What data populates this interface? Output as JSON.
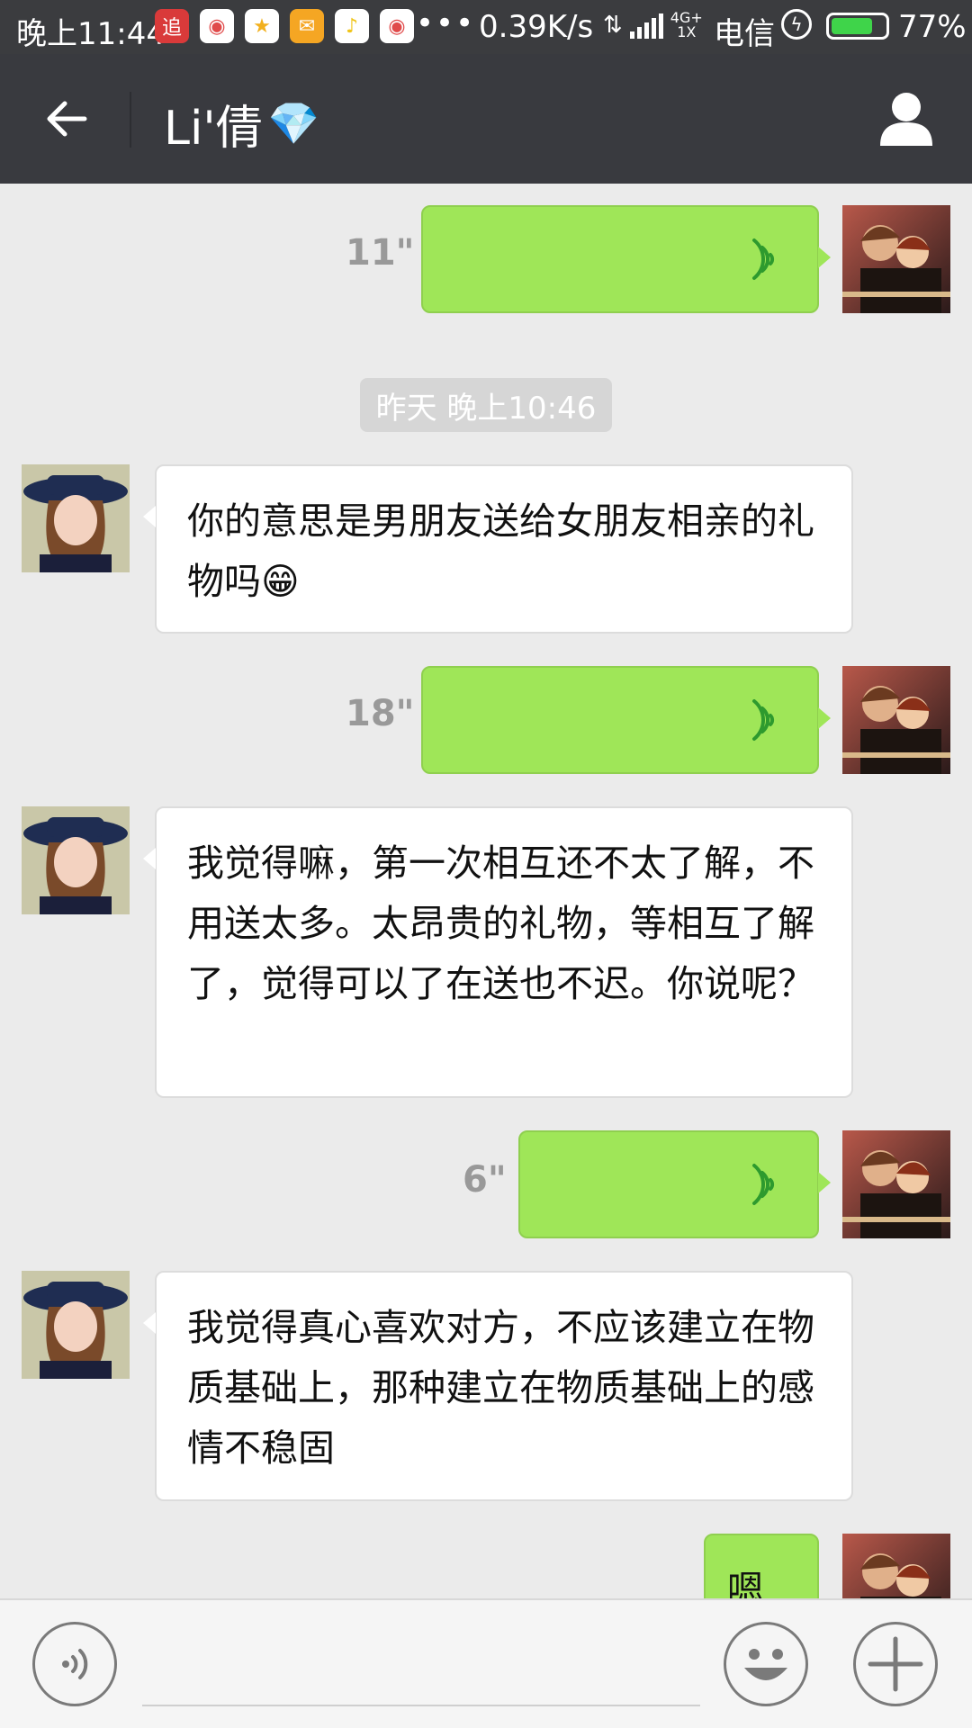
{
  "status_bar": {
    "time": "晚上11:44",
    "app_icons": [
      {
        "name": "zhui-app-icon",
        "glyph": "追",
        "color": "#d93a3a"
      },
      {
        "name": "weibo-app-icon",
        "glyph": "◉",
        "color": "#ffffff"
      },
      {
        "name": "star-app-icon",
        "glyph": "★",
        "color": "#ffffff"
      },
      {
        "name": "mail-app-icon",
        "glyph": "✉",
        "color": "#f5a623"
      },
      {
        "name": "music-app-icon",
        "glyph": "♪",
        "color": "#ffffff"
      },
      {
        "name": "weibo-app-icon",
        "glyph": "◉",
        "color": "#ffffff"
      }
    ],
    "more": "•••",
    "speed": "0.39K/s",
    "network_top": "4G+",
    "network_bottom": "1X",
    "carrier": "电信",
    "battery": "77%",
    "battery_level": 0.77
  },
  "header": {
    "title": "Li'倩",
    "title_emoji": "💎"
  },
  "messages": {
    "voice1": {
      "duration": "11\""
    },
    "timestamp": "昨天 晚上10:46",
    "text1": "你的意思是男朋友送给女朋友相亲的礼物吗",
    "text1_emoji": "😁",
    "voice2": {
      "duration": "18\""
    },
    "text2": "我觉得嘛，第一次相互还不太了解，不用送太多。太昂贵的礼物，等相互了解了，觉得可以了在送也不迟。你说呢？",
    "voice3": {
      "duration": "6\""
    },
    "text3": "我觉得真心喜欢对方，不应该建立在物质基础上，那种建立在物质基础上的感情不稳固",
    "text4_partial": "嗯"
  },
  "colors": {
    "header_bg": "#393a3f",
    "status_bg": "#3b3c3f",
    "chat_bg": "#ebebeb",
    "bubble_out": "#9fe658",
    "bubble_in": "#ffffff",
    "wave": "#2e9a2e"
  },
  "icons": {
    "back": "back-arrow-icon",
    "profile": "person-icon",
    "voice_mode": "voice-icon",
    "emoji": "smiley-icon",
    "more": "plus-icon"
  }
}
